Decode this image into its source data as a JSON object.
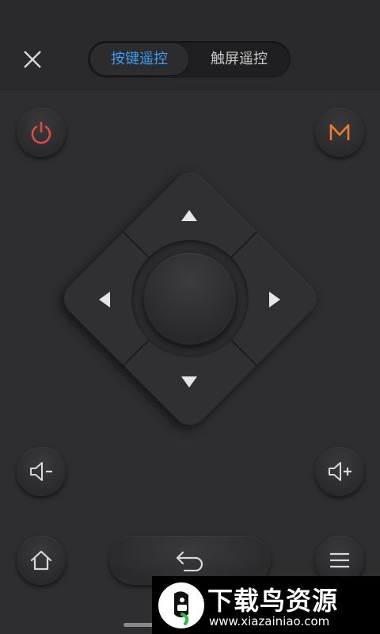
{
  "header": {
    "tabs": [
      {
        "label": "按键遥控",
        "active": true
      },
      {
        "label": "触屏遥控",
        "active": false
      }
    ]
  },
  "buttons": {
    "power": "power-icon",
    "menu_m": "M",
    "vol_down": "volume-down-icon",
    "vol_up": "volume-up-icon",
    "home": "home-icon",
    "back": "back-icon",
    "menu": "hamburger-menu-icon"
  },
  "watermark": {
    "title": "下载鸟资源",
    "url": "www.xiazainiao.com"
  },
  "colors": {
    "accent": "#3b9cf0",
    "power": "#e04a3f",
    "m_letter": "#f07a2c",
    "background": "#2e2e31"
  }
}
